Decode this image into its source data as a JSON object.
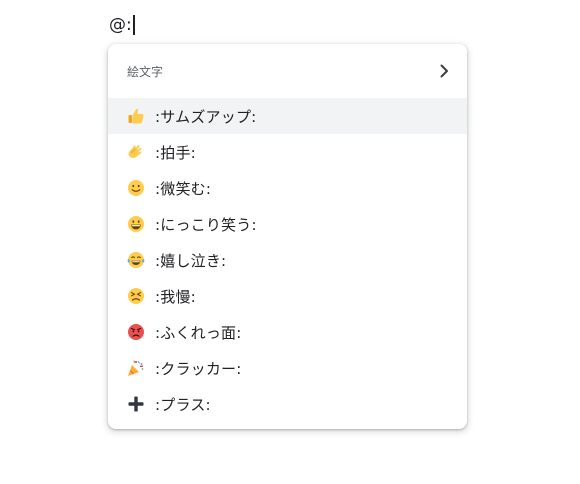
{
  "editor": {
    "text": "@:"
  },
  "popup": {
    "title": "絵文字",
    "items": [
      {
        "icon": "thumbs-up-icon",
        "label": ":サムズアップ:",
        "selected": true
      },
      {
        "icon": "clapping-hands-icon",
        "label": ":拍手:",
        "selected": false
      },
      {
        "icon": "slightly-smiling-face-icon",
        "label": ":微笑む:",
        "selected": false
      },
      {
        "icon": "grinning-face-icon",
        "label": ":にっこり笑う:",
        "selected": false
      },
      {
        "icon": "tears-of-joy-face-icon",
        "label": ":嬉し泣き:",
        "selected": false
      },
      {
        "icon": "persevering-face-icon",
        "label": ":我慢:",
        "selected": false
      },
      {
        "icon": "pouting-face-icon",
        "label": ":ふくれっ面:",
        "selected": false
      },
      {
        "icon": "party-popper-icon",
        "label": ":クラッカー:",
        "selected": false
      },
      {
        "icon": "plus-icon",
        "label": ":プラス:",
        "selected": false
      }
    ]
  },
  "colors": {
    "selected_row": "#f1f3f4",
    "text": "#202124",
    "secondary_text": "#5f6368",
    "emoji_yellow": "#ffcc4d"
  }
}
